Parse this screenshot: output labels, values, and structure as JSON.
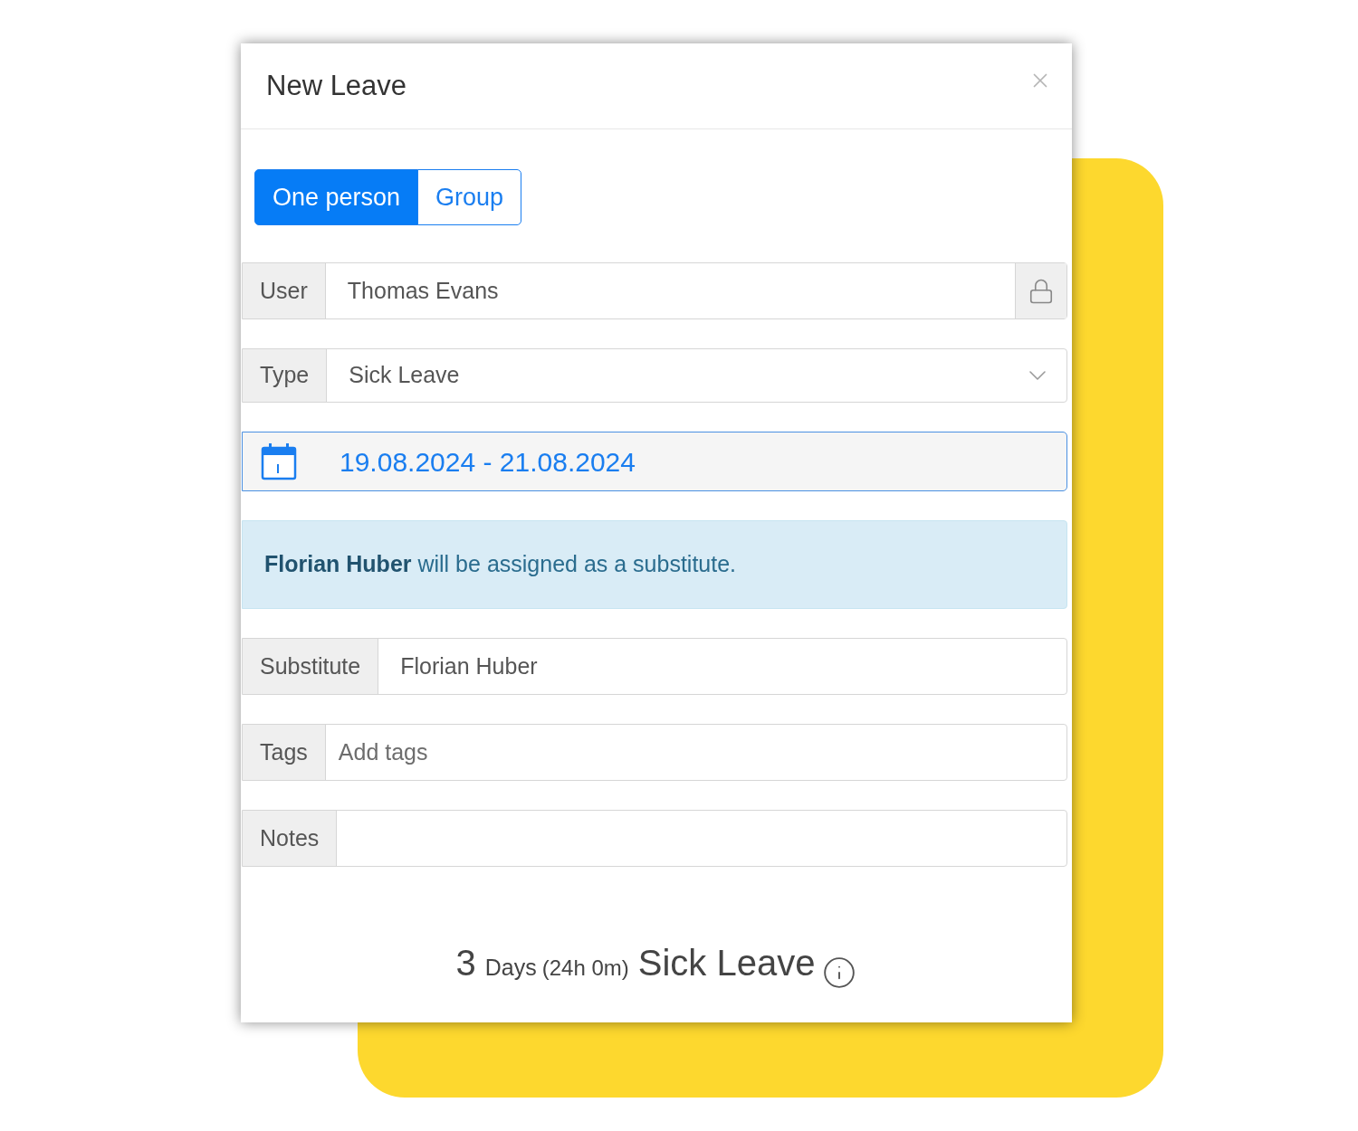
{
  "dialog": {
    "title": "New Leave"
  },
  "mode_toggle": [
    {
      "label": "One person",
      "selected": true
    },
    {
      "label": "Group",
      "selected": false
    }
  ],
  "fields": [
    {
      "kind": "locked",
      "label": "User",
      "value": "Thomas Evans"
    },
    {
      "kind": "select",
      "label": "Type",
      "value": "Sick Leave"
    },
    {
      "kind": "date",
      "value": "19.08.2024 - 21.08.2024"
    },
    {
      "kind": "notice",
      "text": "**Florian Huber** will be assigned as a substitute."
    },
    {
      "kind": "text",
      "label": "Substitute",
      "value": "Florian Huber"
    },
    {
      "kind": "text",
      "label": "Tags",
      "placeholder": "Add tags"
    },
    {
      "kind": "text",
      "label": "Notes"
    }
  ],
  "summary": {
    "count": "3",
    "unit": "Days",
    "duration": "(24h 0m)",
    "type": "Sick Leave"
  }
}
